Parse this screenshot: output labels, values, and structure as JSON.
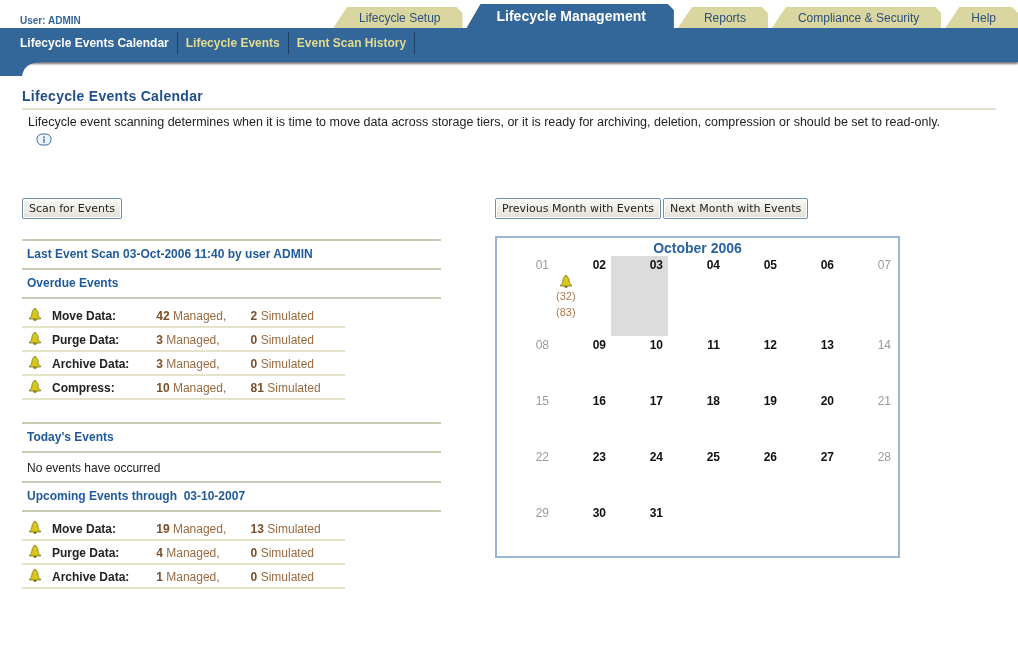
{
  "user": "User: ADMIN",
  "top_tabs": [
    {
      "label": "Lifecycle Setup",
      "selected": false
    },
    {
      "label": "Lifecycle Management",
      "selected": true
    },
    {
      "label": "Reports",
      "selected": false
    },
    {
      "label": "Compliance & Security",
      "selected": false
    },
    {
      "label": "Help",
      "selected": false
    }
  ],
  "sub_tabs": [
    {
      "label": "Lifecycle Events Calendar",
      "selected": true
    },
    {
      "label": "Lifecycle Events",
      "selected": false
    },
    {
      "label": "Event Scan History",
      "selected": false
    }
  ],
  "page_title": "Lifecycle Events Calendar",
  "description": "Lifecycle event scanning determines when it is time to move data across storage tiers, or it is ready for archiving, deletion, compression or should be set to read-only.",
  "scan_button": "Scan for Events",
  "sections": [
    {
      "kind": "events",
      "title": "Last Event Scan 03-Oct-2006 11:40 by user ADMIN"
    },
    {
      "kind": "events",
      "title": "Overdue Events",
      "rows": [
        {
          "label": "Move Data:",
          "managed": "**42** Managed,",
          "simulated": "**2** Simulated"
        },
        {
          "label": "Purge Data:",
          "managed": "**3** Managed,",
          "simulated": "**0** Simulated"
        },
        {
          "label": "Archive Data:",
          "managed": "**3** Managed,",
          "simulated": "**0** Simulated"
        },
        {
          "label": "Compress:",
          "managed": "**10** Managed,",
          "simulated": "**81** Simulated"
        }
      ]
    },
    {
      "kind": "gap"
    },
    {
      "kind": "events",
      "title": "Today's Events",
      "message": "No events have occurred"
    },
    {
      "kind": "events",
      "title": "Upcoming Events through  03-10-2007",
      "rows": [
        {
          "label": "Move Data:",
          "managed": "**19** Managed,",
          "simulated": "**13** Simulated"
        },
        {
          "label": "Purge Data:",
          "managed": "**4** Managed,",
          "simulated": "**0** Simulated"
        },
        {
          "label": "Archive Data:",
          "managed": "**1** Managed,",
          "simulated": "**0** Simulated"
        }
      ]
    }
  ],
  "month_buttons": [
    "Previous Month with Events",
    "Next Month with Events"
  ],
  "calendar": {
    "title": "October 2006",
    "weeks": [
      [
        {
          "day": "01",
          "muted": true,
          "selected": false
        },
        {
          "day": "02",
          "muted": false,
          "selected": false,
          "events": [
            "(32)",
            "(83)"
          ]
        },
        {
          "day": "03",
          "muted": false,
          "selected": true
        },
        {
          "day": "04",
          "muted": false,
          "selected": false
        },
        {
          "day": "05",
          "muted": false,
          "selected": false
        },
        {
          "day": "06",
          "muted": false,
          "selected": false
        },
        {
          "day": "07",
          "muted": true,
          "selected": false
        }
      ],
      [
        {
          "day": "08",
          "muted": true,
          "selected": false
        },
        {
          "day": "09",
          "muted": false,
          "selected": false
        },
        {
          "day": "10",
          "muted": false,
          "selected": false
        },
        {
          "day": "11",
          "muted": false,
          "selected": false
        },
        {
          "day": "12",
          "muted": false,
          "selected": false
        },
        {
          "day": "13",
          "muted": false,
          "selected": false
        },
        {
          "day": "14",
          "muted": true,
          "selected": false
        }
      ],
      [
        {
          "day": "15",
          "muted": true,
          "selected": false
        },
        {
          "day": "16",
          "muted": false,
          "selected": false
        },
        {
          "day": "17",
          "muted": false,
          "selected": false
        },
        {
          "day": "18",
          "muted": false,
          "selected": false
        },
        {
          "day": "19",
          "muted": false,
          "selected": false
        },
        {
          "day": "20",
          "muted": false,
          "selected": false
        },
        {
          "day": "21",
          "muted": true,
          "selected": false
        }
      ],
      [
        {
          "day": "22",
          "muted": true,
          "selected": false
        },
        {
          "day": "23",
          "muted": false,
          "selected": false
        },
        {
          "day": "24",
          "muted": false,
          "selected": false
        },
        {
          "day": "25",
          "muted": false,
          "selected": false
        },
        {
          "day": "26",
          "muted": false,
          "selected": false
        },
        {
          "day": "27",
          "muted": false,
          "selected": false
        },
        {
          "day": "28",
          "muted": true,
          "selected": false
        }
      ],
      [
        {
          "day": "29",
          "muted": true,
          "selected": false
        },
        {
          "day": "30",
          "muted": false,
          "selected": false
        },
        {
          "day": "31",
          "muted": false,
          "selected": false
        }
      ]
    ]
  }
}
